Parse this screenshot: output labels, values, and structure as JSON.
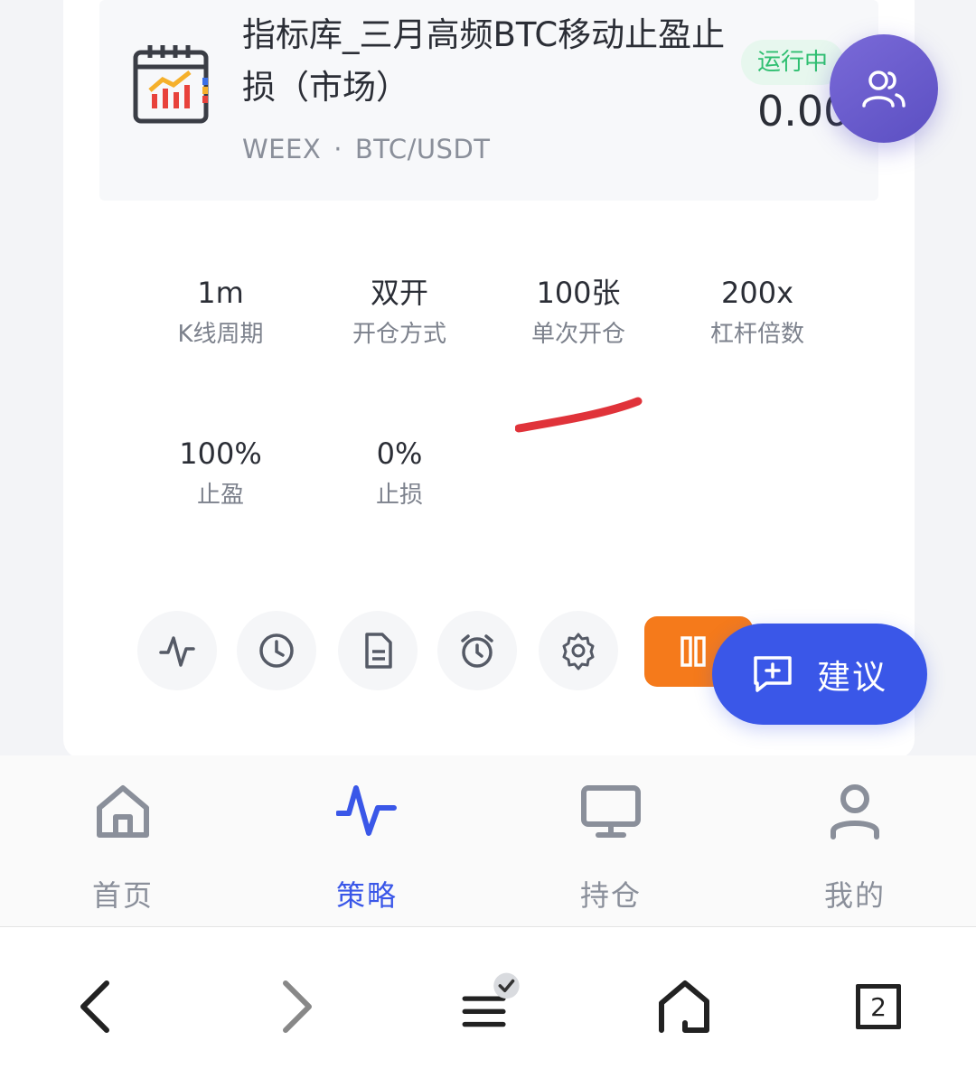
{
  "strategy": {
    "title": "指标库_三月高频BTC移动止盈止损（市场）",
    "exchange": "WEEX",
    "separator": "·",
    "pair": "BTC/USDT",
    "status": "运行中",
    "pnl": "0.00"
  },
  "stats": [
    {
      "value": "1m",
      "label": "K线周期"
    },
    {
      "value": "双开",
      "label": "开仓方式"
    },
    {
      "value": "100张",
      "label": "单次开仓"
    },
    {
      "value": "200x",
      "label": "杠杆倍数"
    },
    {
      "value": "100%",
      "label": "止盈"
    },
    {
      "value": "0%",
      "label": "止损"
    }
  ],
  "actions": [
    "pulse-icon",
    "clock-icon",
    "document-icon",
    "alarm-icon",
    "gear-icon",
    "pause-icon"
  ],
  "suggest_label": "建议",
  "tabs": [
    {
      "label": "首页",
      "icon": "home-icon"
    },
    {
      "label": "策略",
      "icon": "pulse-icon",
      "active": true
    },
    {
      "label": "持仓",
      "icon": "monitor-icon"
    },
    {
      "label": "我的",
      "icon": "user-icon"
    }
  ],
  "browser": {
    "tab_count": "2"
  },
  "colors": {
    "accent": "#3a57e8",
    "pause": "#f57a1b",
    "status_green": "#2fbf71",
    "fab_purple": "#6a5cd0",
    "annotation_red": "#e0333a"
  }
}
